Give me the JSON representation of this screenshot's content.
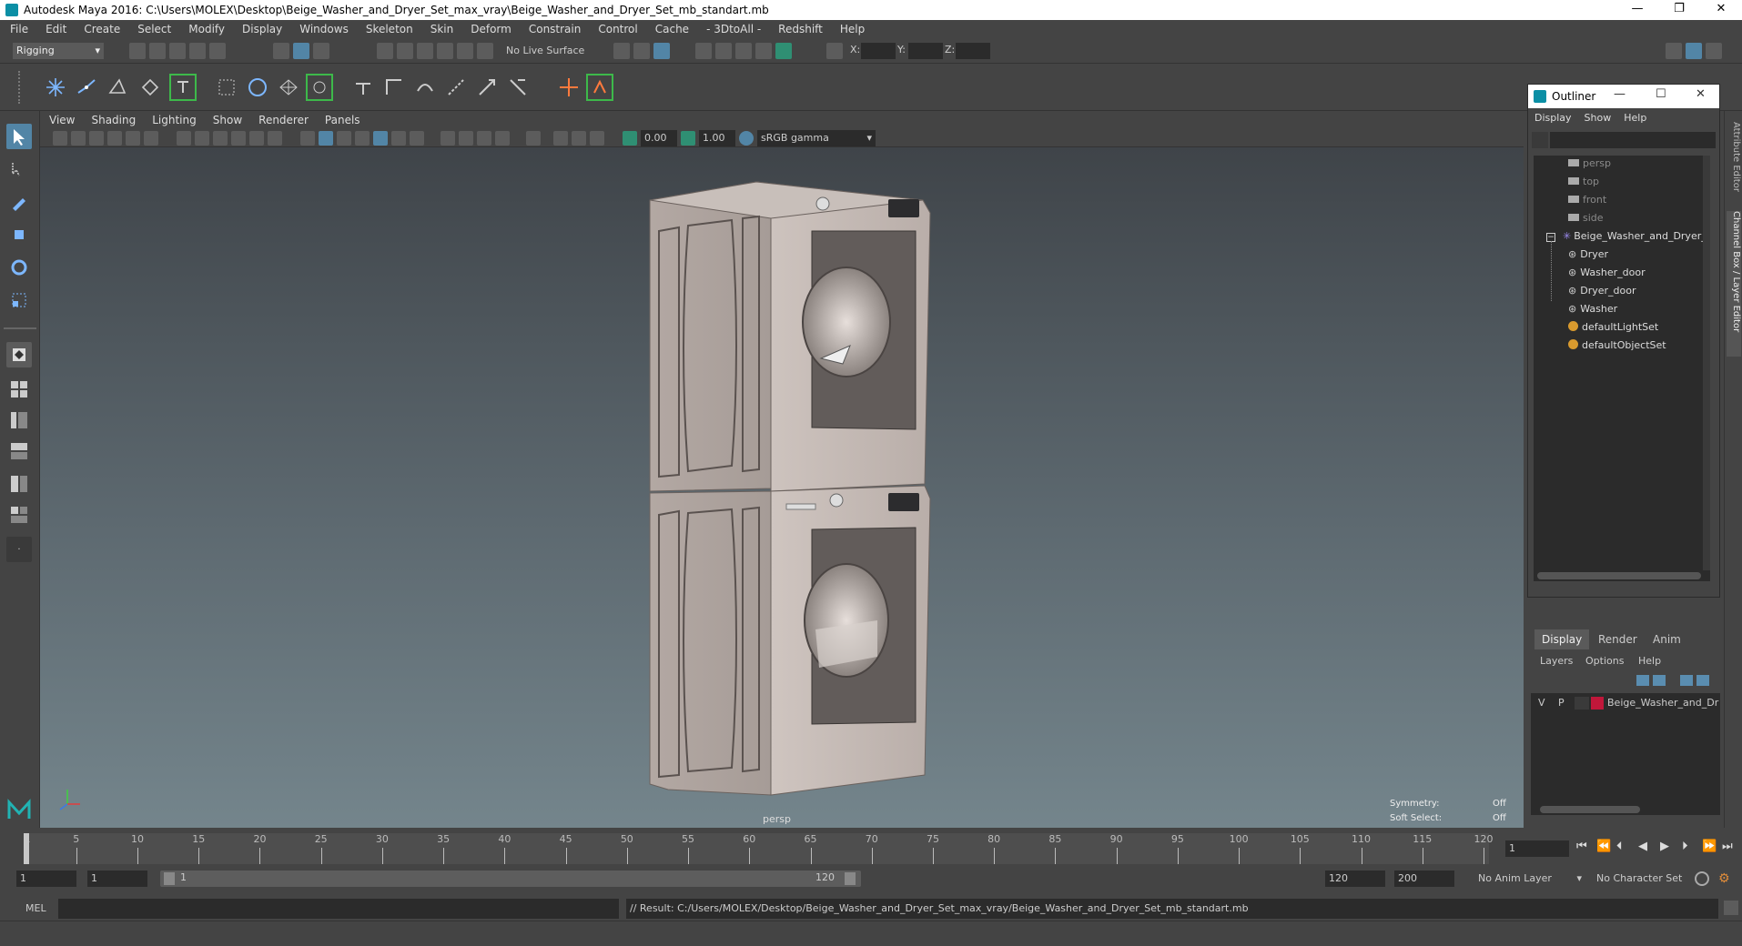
{
  "window": {
    "title": "Autodesk Maya 2016: C:\\Users\\MOLEX\\Desktop\\Beige_Washer_and_Dryer_Set_max_vray\\Beige_Washer_and_Dryer_Set_mb_standart.mb",
    "minimize": "—",
    "restore": "❐",
    "close": "✕"
  },
  "menubar": [
    "File",
    "Edit",
    "Create",
    "Select",
    "Modify",
    "Display",
    "Windows",
    "Skeleton",
    "Skin",
    "Deform",
    "Constrain",
    "Control",
    "Cache",
    "- 3DtoAll -",
    "Redshift",
    "Help"
  ],
  "statusline": {
    "mode": "Rigging",
    "live_surface": "No Live Surface",
    "x_label": "X:",
    "y_label": "Y:",
    "z_label": "Z:"
  },
  "viewport": {
    "menu": [
      "View",
      "Shading",
      "Lighting",
      "Show",
      "Renderer",
      "Panels"
    ],
    "exposure": "0.00",
    "gamma": "1.00",
    "color_space": "sRGB gamma",
    "camera_label": "persp",
    "symmetry_label": "Symmetry:",
    "symmetry_value": "Off",
    "soft_select_label": "Soft Select:",
    "soft_select_value": "Off"
  },
  "outliner": {
    "title": "Outliner",
    "menu": [
      "Display",
      "Show",
      "Help"
    ],
    "items": [
      {
        "label": "persp",
        "dim": true,
        "icon": "camera-icon"
      },
      {
        "label": "top",
        "dim": true,
        "icon": "camera-icon"
      },
      {
        "label": "front",
        "dim": true,
        "icon": "camera-icon"
      },
      {
        "label": "side",
        "dim": true,
        "icon": "camera-icon"
      },
      {
        "label": "Beige_Washer_and_Dryer_",
        "dim": false,
        "icon": "group-icon"
      },
      {
        "label": "Dryer",
        "dim": false,
        "icon": "mesh-icon"
      },
      {
        "label": "Washer_door",
        "dim": false,
        "icon": "mesh-icon"
      },
      {
        "label": "Dryer_door",
        "dim": false,
        "icon": "mesh-icon"
      },
      {
        "label": "Washer",
        "dim": false,
        "icon": "mesh-icon"
      },
      {
        "label": "defaultLightSet",
        "dim": false,
        "icon": "set-icon"
      },
      {
        "label": "defaultObjectSet",
        "dim": false,
        "icon": "set-icon"
      }
    ]
  },
  "side_tabs": {
    "attribute_editor": "Attribute Editor",
    "channel_box": "Channel Box / Layer Editor"
  },
  "layer_editor": {
    "tabs": [
      "Display",
      "Render",
      "Anim"
    ],
    "menu": [
      "Layers",
      "Options",
      "Help"
    ],
    "layer": {
      "v": "V",
      "p": "P",
      "name": "Beige_Washer_and_Dr",
      "color": "#c0173a"
    }
  },
  "timeslider": {
    "ticks": [
      "1",
      "5",
      "10",
      "15",
      "20",
      "25",
      "30",
      "35",
      "40",
      "45",
      "50",
      "55",
      "60",
      "65",
      "70",
      "75",
      "80",
      "85",
      "90",
      "95",
      "100",
      "105",
      "110",
      "115",
      "120"
    ],
    "current_frame": "1"
  },
  "rangeslider": {
    "start": "1",
    "playback_start": "1",
    "range_start_label": "1",
    "range_end_label": "120",
    "playback_end": "120",
    "end": "200",
    "anim_layer": "No Anim Layer",
    "character_set": "No Character Set"
  },
  "cmdline": {
    "language": "MEL",
    "result": "// Result: C:/Users/MOLEX/Desktop/Beige_Washer_and_Dryer_Set_max_vray/Beige_Washer_and_Dryer_Set_mb_standart.mb"
  },
  "colors": {
    "accent": "#5285a6",
    "appliance": "#b6aba5",
    "layer_color": "#c0173a"
  }
}
